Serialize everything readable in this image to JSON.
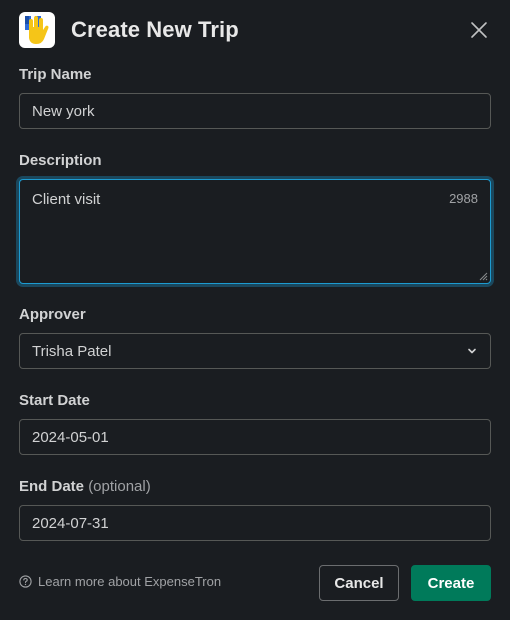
{
  "dialog": {
    "title": "Create New Trip",
    "app_icon": "expensetron-hand-icon",
    "close_icon": "close-icon"
  },
  "form": {
    "trip_name": {
      "label": "Trip Name",
      "value": "New york"
    },
    "description": {
      "label": "Description",
      "value": "Client visit",
      "char_count": "2988"
    },
    "approver": {
      "label": "Approver",
      "value": "Trisha Patel",
      "icon": "chevron-down-icon"
    },
    "start_date": {
      "label": "Start Date",
      "value": "2024-05-01"
    },
    "end_date": {
      "label": "End Date",
      "optional": "(optional)",
      "value": "2024-07-31"
    }
  },
  "footer": {
    "help_text": "Learn more about ExpenseTron",
    "help_icon": "question-circle-icon",
    "cancel_label": "Cancel",
    "create_label": "Create"
  },
  "colors": {
    "background": "#1a1d21",
    "focus_ring": "#1d9bd1",
    "primary_button": "#007a5a"
  }
}
